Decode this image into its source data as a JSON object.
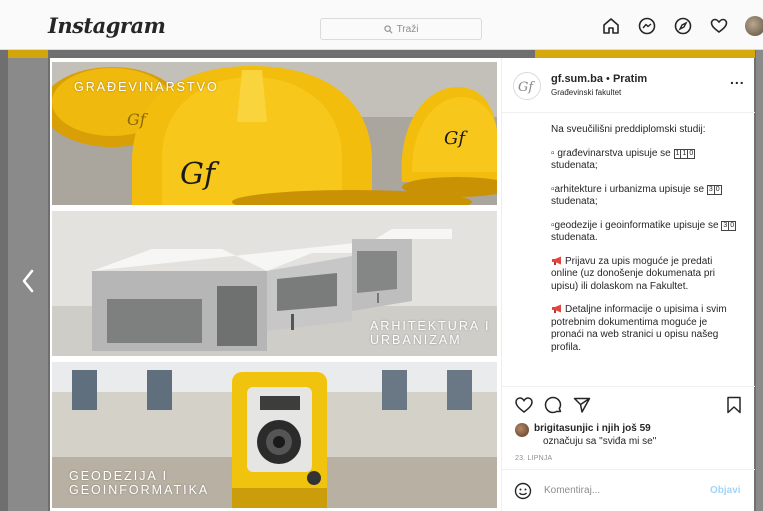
{
  "topbar": {
    "logo": "Instagram",
    "search_placeholder": "Traži"
  },
  "post": {
    "images": [
      {
        "label_line1": "GRAĐEVINARSTVO",
        "label_line2": ""
      },
      {
        "label_line1": "ARHITEKTURA I",
        "label_line2": "URBANIZAM"
      },
      {
        "label_line1": "GEODEZIJA I",
        "label_line2": "GEOINFORMATIKA"
      }
    ]
  },
  "header": {
    "username": "gf.sum.ba",
    "separator": "•",
    "follow_state": "Pratim",
    "subtitle": "Građevinski fakultet",
    "more": "..."
  },
  "caption": {
    "intro": "Na sveučilišni preddiplomski studij:",
    "item1_prefix": "▫ građevinarstva upisuje se",
    "item1_digits": [
      "1",
      "1",
      "0"
    ],
    "item1_suffix": "studenata;",
    "item2_prefix": "▫arhitekture i urbanizma upisuje se",
    "item2_digits": [
      "3",
      "0"
    ],
    "item2_suffix": "studenata;",
    "item3_prefix": "▫geodezije i geoinformatike upisuje se",
    "item3_digits": [
      "3",
      "0"
    ],
    "item3_suffix": "studenata.",
    "note1": "Prijavu za upis moguće je predati online (uz donošenje dokumenata pri upisu) ili dolaskom na Fakultet.",
    "note2": "Detaljne informacije o upisima i svim potrebnim dokumentima moguće je pronaći na web stranici u opisu našeg profila."
  },
  "likes": {
    "line1": "brigitasunjic i njih još 59",
    "line2": "označuju sa \"sviđa mi se\""
  },
  "date": "23. LIPNJA",
  "comment": {
    "placeholder": "Komentiraj...",
    "post_label": "Objavi"
  },
  "colors": {
    "accent_blue": "#0095f6",
    "helmet_yellow": "#f2bd0c"
  }
}
